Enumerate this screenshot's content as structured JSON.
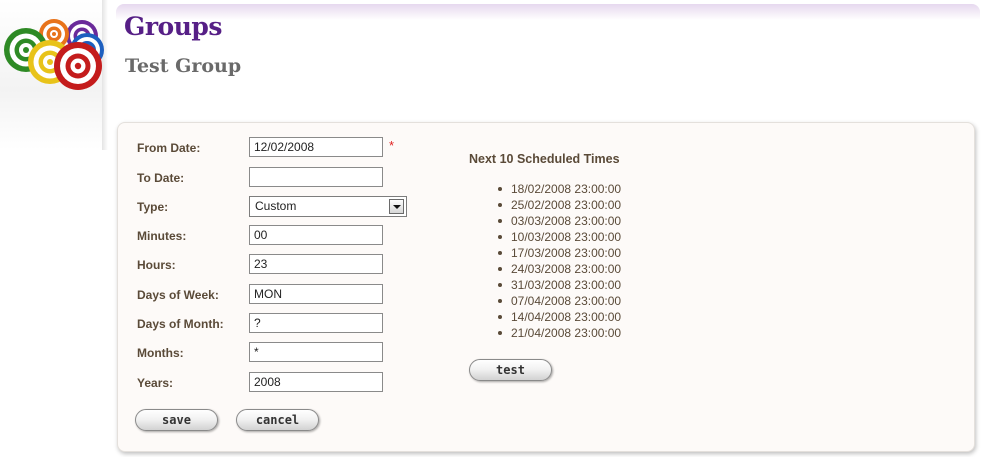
{
  "header": {
    "title": "Groups",
    "subtitle": "Test Group",
    "logo_icon": "targets-logo-icon"
  },
  "form": {
    "from_date": {
      "label": "From Date:",
      "value": "12/02/2008",
      "required_marker": "*"
    },
    "to_date": {
      "label": "To Date:",
      "value": ""
    },
    "type": {
      "label": "Type:",
      "value": "Custom"
    },
    "minutes": {
      "label": "Minutes:",
      "value": "00"
    },
    "hours": {
      "label": "Hours:",
      "value": "23"
    },
    "days_of_week": {
      "label": "Days of Week:",
      "value": "MON"
    },
    "days_of_month": {
      "label": "Days of Month:",
      "value": "?"
    },
    "months": {
      "label": "Months:",
      "value": "*"
    },
    "years": {
      "label": "Years:",
      "value": "2008"
    }
  },
  "schedule": {
    "heading": "Next 10 Scheduled Times",
    "times": [
      "18/02/2008 23:00:00",
      "25/02/2008 23:00:00",
      "03/03/2008 23:00:00",
      "10/03/2008 23:00:00",
      "17/03/2008 23:00:00",
      "24/03/2008 23:00:00",
      "31/03/2008 23:00:00",
      "07/04/2008 23:00:00",
      "14/04/2008 23:00:00",
      "21/04/2008 23:00:00"
    ]
  },
  "buttons": {
    "save": "save",
    "cancel": "cancel",
    "test": "test"
  },
  "colors": {
    "title": "#561f86",
    "label": "#5a4a38",
    "required": "#e02020"
  }
}
